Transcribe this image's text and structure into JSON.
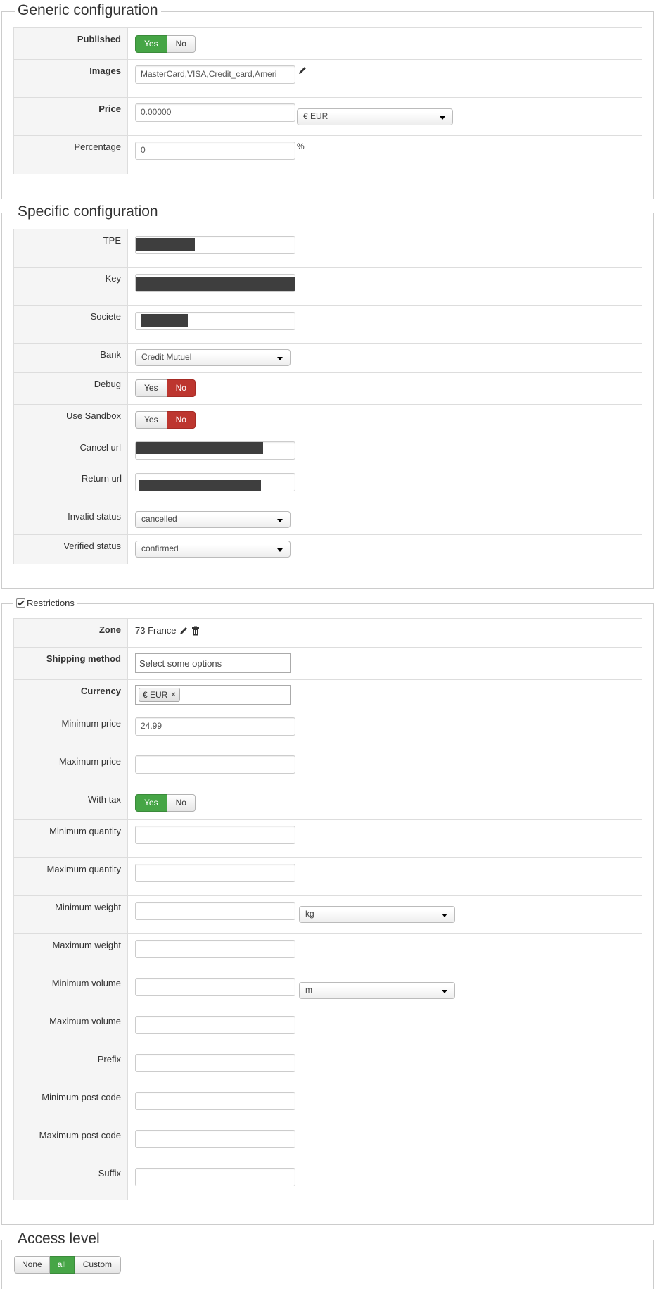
{
  "generic": {
    "legend": "Generic configuration",
    "published_label": "Published",
    "yes": "Yes",
    "no": "No",
    "images_label": "Images",
    "images_value": "MasterCard,VISA,Credit_card,Ameri",
    "price_label": "Price",
    "price_value": "0.00000",
    "currency": "€ EUR",
    "percentage_label": "Percentage",
    "percentage_value": "0",
    "percent_sign": "%"
  },
  "specific": {
    "legend": "Specific configuration",
    "tpe_label": "TPE",
    "key_label": "Key",
    "societe_label": "Societe",
    "bank_label": "Bank",
    "bank_value": "Credit Mutuel",
    "debug_label": "Debug",
    "sandbox_label": "Use Sandbox",
    "yes": "Yes",
    "no": "No",
    "cancel_label": "Cancel url",
    "return_label": "Return url",
    "invalid_label": "Invalid status",
    "invalid_value": "cancelled",
    "verified_label": "Verified status",
    "verified_value": "confirmed"
  },
  "restrictions": {
    "legend": "Restrictions",
    "zone_label": "Zone",
    "zone_value": "73 France",
    "shipping_label": "Shipping method",
    "shipping_placeholder": "Select some options",
    "currency_label": "Currency",
    "currency_tag": "€ EUR",
    "tag_remove": "×",
    "min_price_label": "Minimum price",
    "min_price_value": "24.99",
    "max_price_label": "Maximum price",
    "with_tax_label": "With tax",
    "yes": "Yes",
    "no": "No",
    "min_qty_label": "Minimum quantity",
    "max_qty_label": "Maximum quantity",
    "min_weight_label": "Minimum weight",
    "weight_unit": "kg",
    "max_weight_label": "Maximum weight",
    "min_volume_label": "Minimum volume",
    "volume_unit": "m",
    "max_volume_label": "Maximum volume",
    "prefix_label": "Prefix",
    "min_post_label": "Minimum post code",
    "max_post_label": "Maximum post code",
    "suffix_label": "Suffix"
  },
  "access": {
    "legend": "Access level",
    "none": "None",
    "all": "all",
    "custom": "Custom"
  },
  "colors": {
    "yes_active": "#46a546",
    "no_active": "#bd362f"
  }
}
